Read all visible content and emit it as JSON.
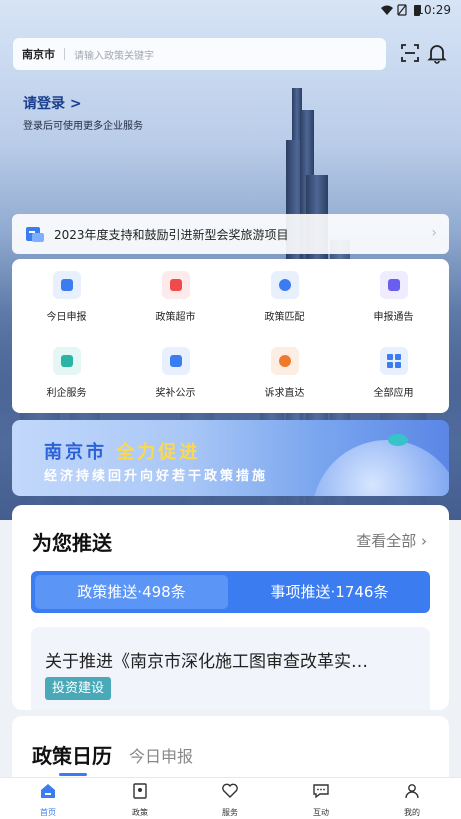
{
  "status_bar": {
    "time": "10:29"
  },
  "search": {
    "city": "南京市",
    "placeholder": "请输入政策关键字"
  },
  "login": {
    "title": "请登录 >",
    "subtitle": "登录后可使用更多企业服务"
  },
  "notice": {
    "text": "2023年度支持和鼓励引进新型会奖旅游项目",
    "chevron": "›"
  },
  "grid": {
    "items": [
      {
        "label": "今日申报",
        "icon": "calendar-upload-icon",
        "color": "#3b7cf0",
        "bg": "#e8f0fe"
      },
      {
        "label": "政策超市",
        "icon": "cart-icon",
        "color": "#ef4b4b",
        "bg": "#fdeaea"
      },
      {
        "label": "政策匹配",
        "icon": "target-icon",
        "color": "#3b7cf0",
        "bg": "#e8f0fe"
      },
      {
        "label": "申报通告",
        "icon": "megaphone-icon",
        "color": "#6a5ef0",
        "bg": "#eeecfe"
      },
      {
        "label": "利企服务",
        "icon": "building-icon",
        "color": "#2bb3a3",
        "bg": "#e4f7f4"
      },
      {
        "label": "奖补公示",
        "icon": "box-icon",
        "color": "#3b7cf0",
        "bg": "#e8f0fe"
      },
      {
        "label": "诉求直达",
        "icon": "chat-icon",
        "color": "#f07a2b",
        "bg": "#fdeee3"
      },
      {
        "label": "全部应用",
        "icon": "apps-icon",
        "color": "#3b7cf0",
        "bg": "#e8f0fe"
      }
    ]
  },
  "banner": {
    "city": "南京市",
    "highlight": "全力促进",
    "subtitle": "经济持续回升向好若干政策措施"
  },
  "push": {
    "title": "为您推送",
    "more": "查看全部 ›",
    "tabs": [
      {
        "label": "政策推送·498条"
      },
      {
        "label": "事项推送·1746条"
      }
    ],
    "card": {
      "title": "关于推进《南京市深化施工图审查改革实…",
      "tag": "投资建设"
    }
  },
  "calendar": {
    "title": "政策日历",
    "subtitle": "今日申报"
  },
  "nav": {
    "items": [
      {
        "label": "首页",
        "icon": "home-icon"
      },
      {
        "label": "政策",
        "icon": "policy-icon"
      },
      {
        "label": "服务",
        "icon": "heart-icon"
      },
      {
        "label": "互动",
        "icon": "message-icon"
      },
      {
        "label": "我的",
        "icon": "user-icon"
      }
    ]
  },
  "colors": {
    "accent": "#3b7cf0",
    "tag": "#4aa9b8"
  }
}
